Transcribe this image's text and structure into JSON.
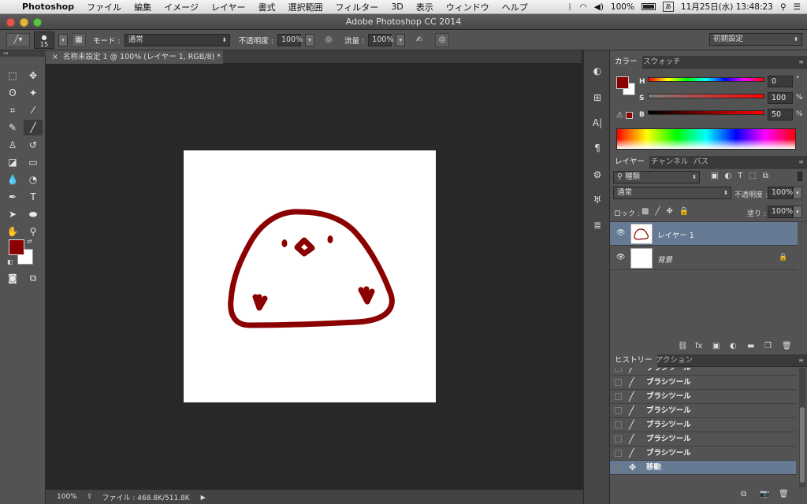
{
  "menubar": {
    "app": "Photoshop",
    "items": [
      "ファイル",
      "編集",
      "イメージ",
      "レイヤー",
      "書式",
      "選択範囲",
      "フィルター",
      "3D",
      "表示",
      "ウィンドウ",
      "ヘルプ"
    ],
    "battery": "100%",
    "datetime": "11月25日(水)  13:48:23"
  },
  "window": {
    "title": "Adobe Photoshop CC 2014"
  },
  "options": {
    "brush_size": "15",
    "mode_label": "モード :",
    "mode_value": "通常",
    "opacity_label": "不透明度 :",
    "opacity_value": "100%",
    "flow_label": "流量 :",
    "flow_value": "100%",
    "workspace": "初期設定"
  },
  "document": {
    "tab_title": "名称未設定 1 @ 100% (レイヤー 1, RGB/8) *"
  },
  "status": {
    "zoom": "100%",
    "file_info": "ファイル : 468.8K/511.8K"
  },
  "color_panel": {
    "tabs": [
      "カラー",
      "スウォッチ"
    ],
    "h_label": "H",
    "h_value": "0",
    "h_unit": "°",
    "s_label": "S",
    "s_value": "100",
    "s_unit": "%",
    "b_label": "B",
    "b_value": "50",
    "b_unit": "%",
    "foreground": "#8b0000",
    "background": "#ffffff"
  },
  "layers_panel": {
    "tabs": [
      "レイヤー",
      "チャンネル",
      "パス"
    ],
    "filter_label": "種類",
    "blend_mode": "通常",
    "opacity_label": "不透明度 :",
    "opacity_value": "100%",
    "lock_label": "ロック :",
    "fill_label": "塗り :",
    "fill_value": "100%",
    "layers": [
      {
        "name": "レイヤー 1",
        "selected": true
      },
      {
        "name": "背景",
        "selected": false
      }
    ]
  },
  "history_panel": {
    "tabs": [
      "ヒストリー",
      "アクション"
    ],
    "items": [
      {
        "label": "ブラシツール"
      },
      {
        "label": "ブラシツール"
      },
      {
        "label": "ブラシツール"
      },
      {
        "label": "ブラシツール"
      },
      {
        "label": "ブラシツール"
      },
      {
        "label": "ブラシツール"
      },
      {
        "label": "ブラシツール"
      },
      {
        "label": "移動",
        "selected": true
      }
    ]
  },
  "colors": {
    "ui_panel": "#535353",
    "canvas_bg": "#282828",
    "selected": "#667a93",
    "drawing": "#8b0000"
  }
}
